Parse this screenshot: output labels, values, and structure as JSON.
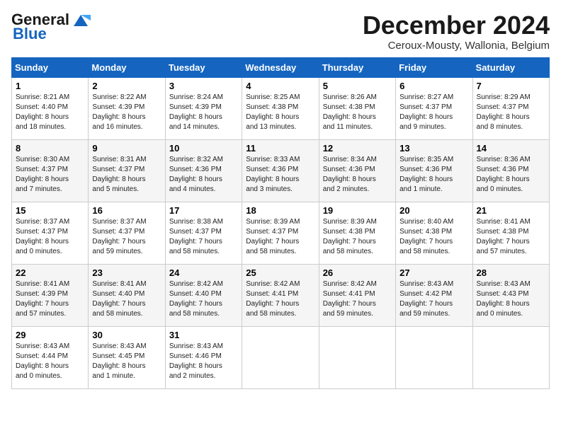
{
  "header": {
    "logo_line1": "General",
    "logo_line2": "Blue",
    "title": "December 2024",
    "subtitle": "Ceroux-Mousty, Wallonia, Belgium"
  },
  "days_of_week": [
    "Sunday",
    "Monday",
    "Tuesday",
    "Wednesday",
    "Thursday",
    "Friday",
    "Saturday"
  ],
  "weeks": [
    [
      {
        "day": "1",
        "info": "Sunrise: 8:21 AM\nSunset: 4:40 PM\nDaylight: 8 hours\nand 18 minutes."
      },
      {
        "day": "2",
        "info": "Sunrise: 8:22 AM\nSunset: 4:39 PM\nDaylight: 8 hours\nand 16 minutes."
      },
      {
        "day": "3",
        "info": "Sunrise: 8:24 AM\nSunset: 4:39 PM\nDaylight: 8 hours\nand 14 minutes."
      },
      {
        "day": "4",
        "info": "Sunrise: 8:25 AM\nSunset: 4:38 PM\nDaylight: 8 hours\nand 13 minutes."
      },
      {
        "day": "5",
        "info": "Sunrise: 8:26 AM\nSunset: 4:38 PM\nDaylight: 8 hours\nand 11 minutes."
      },
      {
        "day": "6",
        "info": "Sunrise: 8:27 AM\nSunset: 4:37 PM\nDaylight: 8 hours\nand 9 minutes."
      },
      {
        "day": "7",
        "info": "Sunrise: 8:29 AM\nSunset: 4:37 PM\nDaylight: 8 hours\nand 8 minutes."
      }
    ],
    [
      {
        "day": "8",
        "info": "Sunrise: 8:30 AM\nSunset: 4:37 PM\nDaylight: 8 hours\nand 7 minutes."
      },
      {
        "day": "9",
        "info": "Sunrise: 8:31 AM\nSunset: 4:37 PM\nDaylight: 8 hours\nand 5 minutes."
      },
      {
        "day": "10",
        "info": "Sunrise: 8:32 AM\nSunset: 4:36 PM\nDaylight: 8 hours\nand 4 minutes."
      },
      {
        "day": "11",
        "info": "Sunrise: 8:33 AM\nSunset: 4:36 PM\nDaylight: 8 hours\nand 3 minutes."
      },
      {
        "day": "12",
        "info": "Sunrise: 8:34 AM\nSunset: 4:36 PM\nDaylight: 8 hours\nand 2 minutes."
      },
      {
        "day": "13",
        "info": "Sunrise: 8:35 AM\nSunset: 4:36 PM\nDaylight: 8 hours\nand 1 minute."
      },
      {
        "day": "14",
        "info": "Sunrise: 8:36 AM\nSunset: 4:36 PM\nDaylight: 8 hours\nand 0 minutes."
      }
    ],
    [
      {
        "day": "15",
        "info": "Sunrise: 8:37 AM\nSunset: 4:37 PM\nDaylight: 8 hours\nand 0 minutes."
      },
      {
        "day": "16",
        "info": "Sunrise: 8:37 AM\nSunset: 4:37 PM\nDaylight: 7 hours\nand 59 minutes."
      },
      {
        "day": "17",
        "info": "Sunrise: 8:38 AM\nSunset: 4:37 PM\nDaylight: 7 hours\nand 58 minutes."
      },
      {
        "day": "18",
        "info": "Sunrise: 8:39 AM\nSunset: 4:37 PM\nDaylight: 7 hours\nand 58 minutes."
      },
      {
        "day": "19",
        "info": "Sunrise: 8:39 AM\nSunset: 4:38 PM\nDaylight: 7 hours\nand 58 minutes."
      },
      {
        "day": "20",
        "info": "Sunrise: 8:40 AM\nSunset: 4:38 PM\nDaylight: 7 hours\nand 58 minutes."
      },
      {
        "day": "21",
        "info": "Sunrise: 8:41 AM\nSunset: 4:38 PM\nDaylight: 7 hours\nand 57 minutes."
      }
    ],
    [
      {
        "day": "22",
        "info": "Sunrise: 8:41 AM\nSunset: 4:39 PM\nDaylight: 7 hours\nand 57 minutes."
      },
      {
        "day": "23",
        "info": "Sunrise: 8:41 AM\nSunset: 4:40 PM\nDaylight: 7 hours\nand 58 minutes."
      },
      {
        "day": "24",
        "info": "Sunrise: 8:42 AM\nSunset: 4:40 PM\nDaylight: 7 hours\nand 58 minutes."
      },
      {
        "day": "25",
        "info": "Sunrise: 8:42 AM\nSunset: 4:41 PM\nDaylight: 7 hours\nand 58 minutes."
      },
      {
        "day": "26",
        "info": "Sunrise: 8:42 AM\nSunset: 4:41 PM\nDaylight: 7 hours\nand 59 minutes."
      },
      {
        "day": "27",
        "info": "Sunrise: 8:43 AM\nSunset: 4:42 PM\nDaylight: 7 hours\nand 59 minutes."
      },
      {
        "day": "28",
        "info": "Sunrise: 8:43 AM\nSunset: 4:43 PM\nDaylight: 8 hours\nand 0 minutes."
      }
    ],
    [
      {
        "day": "29",
        "info": "Sunrise: 8:43 AM\nSunset: 4:44 PM\nDaylight: 8 hours\nand 0 minutes."
      },
      {
        "day": "30",
        "info": "Sunrise: 8:43 AM\nSunset: 4:45 PM\nDaylight: 8 hours\nand 1 minute."
      },
      {
        "day": "31",
        "info": "Sunrise: 8:43 AM\nSunset: 4:46 PM\nDaylight: 8 hours\nand 2 minutes."
      },
      null,
      null,
      null,
      null
    ]
  ]
}
